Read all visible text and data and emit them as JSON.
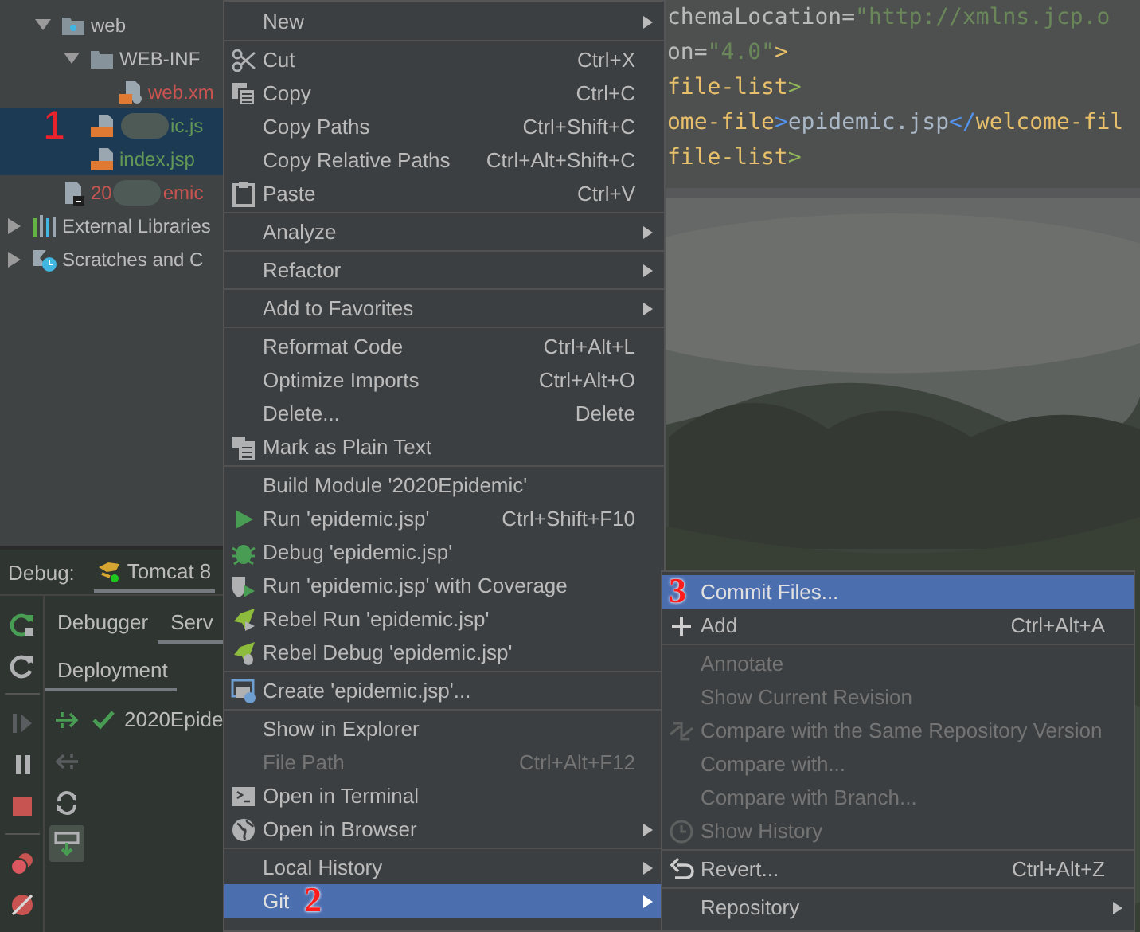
{
  "tree": {
    "annotation": "1",
    "module_items": [
      {
        "label": "web",
        "kind": "web-folder",
        "color": "#bbbbbb",
        "selected": false,
        "expanded": true,
        "children": [
          {
            "label": "WEB-INF",
            "kind": "folder",
            "color": "#bbbbbb",
            "selected": false,
            "expanded": true,
            "children": [
              {
                "label": "web.xm",
                "kind": "xml",
                "color": "#c75450",
                "selected": false
              }
            ]
          },
          {
            "label": "ic.js",
            "kind": "jsp",
            "color": "#629755",
            "selected": true,
            "redacted": true
          },
          {
            "label": "index.jsp",
            "kind": "jsp",
            "color": "#629755",
            "selected": true
          }
        ]
      },
      {
        "prefix": "20",
        "label": "emic",
        "kind": "module",
        "color": "#c75450",
        "selected": false,
        "redacted": true
      }
    ],
    "root_items": [
      {
        "label": "External Libraries",
        "kind": "libraries",
        "color": "#bbbbbb",
        "selected": false,
        "expanded": false
      },
      {
        "label": "Scratches and C",
        "kind": "scratches",
        "color": "#bbbbbb",
        "selected": false,
        "expanded": false
      }
    ]
  },
  "debug": {
    "label": "Debug:",
    "tabs": [
      {
        "label": "Tomcat 8",
        "selected": true
      }
    ],
    "view_tabs": [
      {
        "label": "Debugger",
        "selected": false
      },
      {
        "label": "Serv",
        "selected": true
      }
    ],
    "sub_tabs": [
      {
        "label": "Deployment",
        "selected": true
      }
    ],
    "deployments": [
      {
        "label": "2020Epide"
      }
    ]
  },
  "editor": {
    "lines": [
      [
        {
          "text": "chemaLocation=",
          "color": "#bababa"
        },
        {
          "text": "\"http://xmlns.jcp.o",
          "color": "#6a8759"
        }
      ],
      [
        {
          "text": "on=",
          "color": "#bababa"
        },
        {
          "text": "\"4.0\"",
          "color": "#6a8759"
        },
        {
          "text": ">",
          "color": "#e8bf6a"
        }
      ],
      [
        {
          "text": "file-list",
          "color": "#e8bf6a"
        },
        {
          "text": ">",
          "color": "#8fb558"
        }
      ],
      [
        {
          "text": "ome-file",
          "color": "#e8bf6a"
        },
        {
          "text": ">",
          "color": "#5394ec"
        },
        {
          "text": "epidemic.jsp",
          "color": "#a9b7c6"
        },
        {
          "text": "</",
          "color": "#5394ec"
        },
        {
          "text": "welcome-fil",
          "color": "#e8bf6a"
        }
      ],
      [
        {
          "text": "file-list",
          "color": "#e8bf6a"
        },
        {
          "text": ">",
          "color": "#8fb558"
        }
      ]
    ]
  },
  "menu": {
    "items": [
      {
        "kind": "item",
        "label": "New",
        "submenu": true,
        "disabled": false,
        "selected": false
      },
      {
        "kind": "separator"
      },
      {
        "kind": "item",
        "label": "Cut",
        "shortcut": "Ctrl+X",
        "submenu": false,
        "disabled": false,
        "selected": false
      },
      {
        "kind": "item",
        "label": "Copy",
        "shortcut": "Ctrl+C",
        "submenu": false,
        "disabled": false,
        "selected": false
      },
      {
        "kind": "item",
        "label": "Copy Paths",
        "shortcut": "Ctrl+Shift+C",
        "submenu": false,
        "disabled": false,
        "selected": false
      },
      {
        "kind": "item",
        "label": "Copy Relative Paths",
        "shortcut": "Ctrl+Alt+Shift+C",
        "submenu": false,
        "disabled": false,
        "selected": false
      },
      {
        "kind": "item",
        "label": "Paste",
        "shortcut": "Ctrl+V",
        "submenu": false,
        "disabled": false,
        "selected": false
      },
      {
        "kind": "separator"
      },
      {
        "kind": "item",
        "label": "Analyze",
        "submenu": true,
        "disabled": false,
        "selected": false
      },
      {
        "kind": "separator"
      },
      {
        "kind": "item",
        "label": "Refactor",
        "submenu": true,
        "disabled": false,
        "selected": false
      },
      {
        "kind": "separator"
      },
      {
        "kind": "item",
        "label": "Add to Favorites",
        "submenu": true,
        "disabled": false,
        "selected": false
      },
      {
        "kind": "separator"
      },
      {
        "kind": "item",
        "label": "Reformat Code",
        "shortcut": "Ctrl+Alt+L",
        "submenu": false,
        "disabled": false,
        "selected": false
      },
      {
        "kind": "item",
        "label": "Optimize Imports",
        "shortcut": "Ctrl+Alt+O",
        "submenu": false,
        "disabled": false,
        "selected": false
      },
      {
        "kind": "item",
        "label": "Delete...",
        "shortcut": "Delete",
        "submenu": false,
        "disabled": false,
        "selected": false
      },
      {
        "kind": "item",
        "label": "Mark as Plain Text",
        "submenu": false,
        "disabled": false,
        "selected": false
      },
      {
        "kind": "separator"
      },
      {
        "kind": "item",
        "label": "Build Module '2020Epidemic'",
        "submenu": false,
        "disabled": false,
        "selected": false
      },
      {
        "kind": "item",
        "label": "Run 'epidemic.jsp'",
        "shortcut": "Ctrl+Shift+F10",
        "submenu": false,
        "disabled": false,
        "selected": false
      },
      {
        "kind": "item",
        "label": "Debug 'epidemic.jsp'",
        "submenu": false,
        "disabled": false,
        "selected": false
      },
      {
        "kind": "item",
        "label": "Run 'epidemic.jsp' with Coverage",
        "submenu": false,
        "disabled": false,
        "selected": false
      },
      {
        "kind": "item",
        "label": "Rebel Run 'epidemic.jsp'",
        "submenu": false,
        "disabled": false,
        "selected": false
      },
      {
        "kind": "item",
        "label": "Rebel Debug 'epidemic.jsp'",
        "submenu": false,
        "disabled": false,
        "selected": false
      },
      {
        "kind": "separator"
      },
      {
        "kind": "item",
        "label": "Create 'epidemic.jsp'...",
        "submenu": false,
        "disabled": false,
        "selected": false
      },
      {
        "kind": "separator"
      },
      {
        "kind": "item",
        "label": "Show in Explorer",
        "submenu": false,
        "disabled": false,
        "selected": false
      },
      {
        "kind": "item",
        "label": "File Path",
        "shortcut": "Ctrl+Alt+F12",
        "submenu": false,
        "disabled": true,
        "selected": false
      },
      {
        "kind": "item",
        "label": "Open in Terminal",
        "submenu": false,
        "disabled": false,
        "selected": false
      },
      {
        "kind": "item",
        "label": "Open in Browser",
        "submenu": true,
        "disabled": false,
        "selected": false
      },
      {
        "kind": "separator"
      },
      {
        "kind": "item",
        "label": "Local History",
        "submenu": true,
        "disabled": false,
        "selected": false
      },
      {
        "kind": "item",
        "label": "Git",
        "annotation": "2",
        "submenu": true,
        "disabled": false,
        "selected": true
      }
    ]
  },
  "git_menu": {
    "items": [
      {
        "kind": "item",
        "label": "Commit Files...",
        "annotation": "3",
        "submenu": false,
        "disabled": false,
        "selected": true
      },
      {
        "kind": "item",
        "label": "Add",
        "shortcut": "Ctrl+Alt+A",
        "submenu": false,
        "disabled": false,
        "selected": false
      },
      {
        "kind": "separator"
      },
      {
        "kind": "item",
        "label": "Annotate",
        "submenu": false,
        "disabled": true,
        "selected": false
      },
      {
        "kind": "item",
        "label": "Show Current Revision",
        "submenu": false,
        "disabled": true,
        "selected": false
      },
      {
        "kind": "item",
        "label": "Compare with the Same Repository Version",
        "submenu": false,
        "disabled": true,
        "selected": false
      },
      {
        "kind": "item",
        "label": "Compare with...",
        "submenu": false,
        "disabled": true,
        "selected": false
      },
      {
        "kind": "item",
        "label": "Compare with Branch...",
        "submenu": false,
        "disabled": true,
        "selected": false
      },
      {
        "kind": "item",
        "label": "Show History",
        "submenu": false,
        "disabled": true,
        "selected": false
      },
      {
        "kind": "separator"
      },
      {
        "kind": "item",
        "label": "Revert...",
        "shortcut": "Ctrl+Alt+Z",
        "submenu": false,
        "disabled": false,
        "selected": false
      },
      {
        "kind": "separator"
      },
      {
        "kind": "item",
        "label": "Repository",
        "submenu": true,
        "disabled": false,
        "selected": false
      }
    ]
  }
}
